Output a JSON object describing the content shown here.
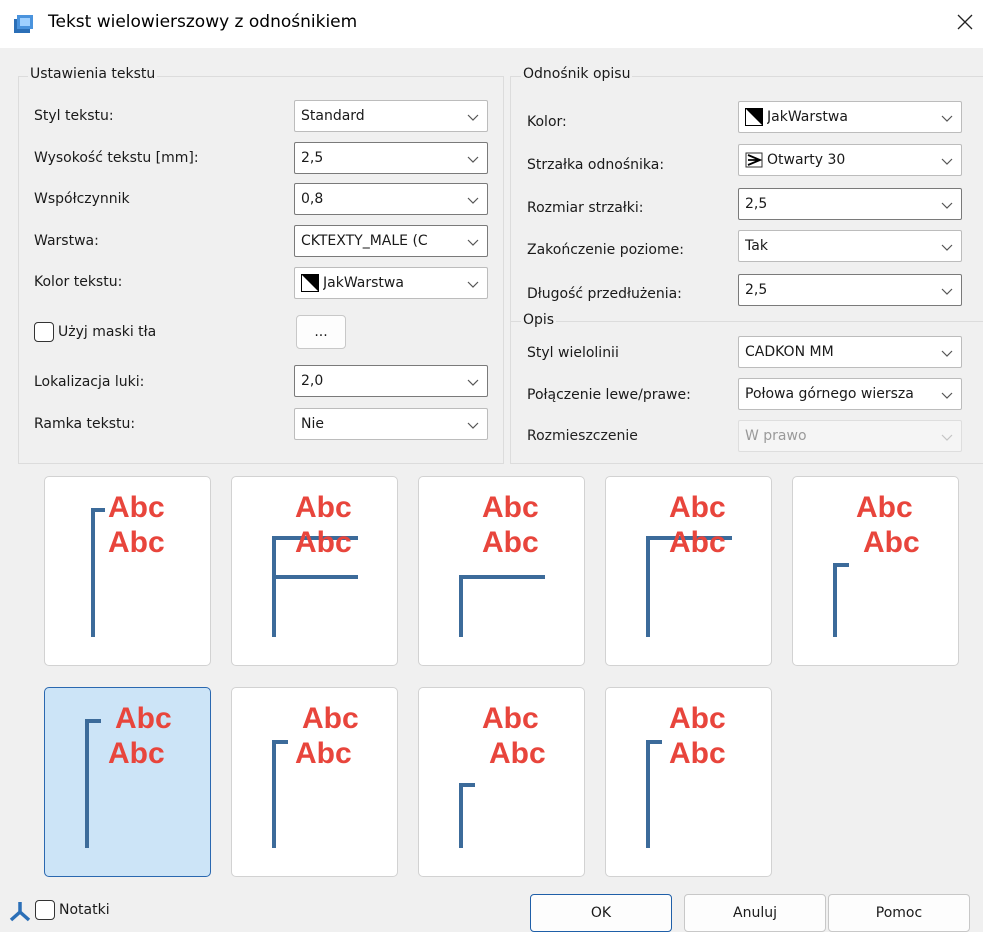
{
  "window": {
    "title": "Tekst wielowierszowy z odnośnikiem",
    "close_glyph": "✕"
  },
  "text_settings": {
    "group_title": "Ustawienia tekstu",
    "style_label": "Styl tekstu:",
    "style_value": "Standard",
    "height_label": "Wysokość tekstu [mm]:",
    "height_value": "2,5",
    "factor_label": "Współczynnik",
    "factor_value": "0,8",
    "layer_label": "Warstwa:",
    "layer_value": "CKTEXTY_MALE  (C",
    "color_label": "Kolor tekstu:",
    "color_value": "JakWarstwa",
    "mask_label": "Użyj maski tła",
    "mask_checked": false,
    "mask_button": "...",
    "gap_label": "Lokalizacja luki:",
    "gap_value": "2,0",
    "frame_label": "Ramka tekstu:",
    "frame_value": "Nie"
  },
  "leader": {
    "group_title": "Odnośnik opisu",
    "color_label": "Kolor:",
    "color_value": "JakWarstwa",
    "arrow_label": "Strzałka odnośnika:",
    "arrow_value": "Otwarty 30",
    "arrow_size_label": "Rozmiar strzałki:",
    "arrow_size_value": "2,5",
    "horizontal_label": "Zakończenie poziome:",
    "horizontal_value": "Tak",
    "extension_label": "Długość przedłużenia:",
    "extension_value": "2,5"
  },
  "description": {
    "group_title": "Opis",
    "mline_label": "Styl wielolinii",
    "mline_value": "CADKON MM",
    "connection_label": "Połączenie lewe/prawe:",
    "connection_value": "Połowa górnego wiersza",
    "placement_label": "Rozmieszczenie",
    "placement_value": "W prawo"
  },
  "layouts": {
    "text": "Abc",
    "selected_index": 5,
    "text_color": "#e8453c",
    "leader_color": "#3c6b9a",
    "tiles": [
      "top-bracket",
      "underline-both",
      "underline-bottom",
      "underline-top",
      "bracket-mid-second",
      "bracket-mid-first",
      "bracket-mid-first-second",
      "bracket-mid-second-low",
      "bracket-top-second"
    ]
  },
  "footer": {
    "notes_label": "Notatki",
    "notes_checked": false,
    "ok_label": "OK",
    "cancel_label": "Anuluj",
    "help_label": "Pomoc"
  }
}
